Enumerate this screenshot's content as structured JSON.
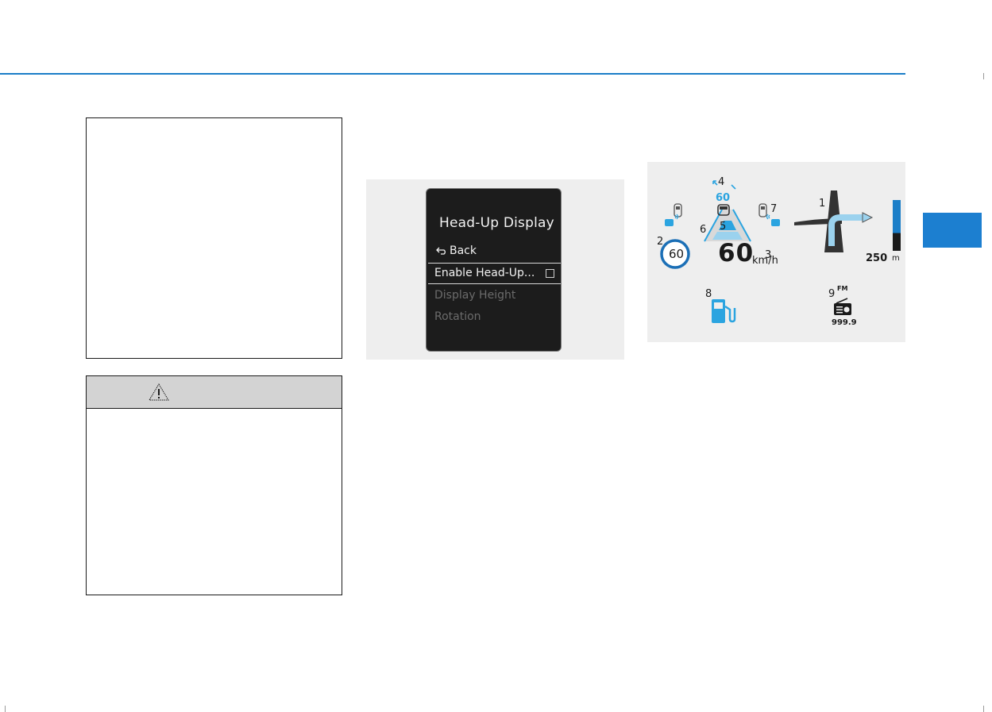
{
  "colors": {
    "accent": "#1b7ec8",
    "tab": "#1c7fd0",
    "hud_blue": "#2ba4e0",
    "lcd_bg": "#1c1c1c",
    "figure_bg": "#eeeeee",
    "warning_header": "#d3d3d3"
  },
  "lcd_menu": {
    "title": "Head-Up Display",
    "back_label": "Back",
    "selected_item": "Enable Head-Up...",
    "selected_checked": false,
    "items": [
      "Display Height",
      "Rotation"
    ]
  },
  "hud": {
    "callouts": [
      "1",
      "2",
      "3",
      "4",
      "5",
      "6",
      "7",
      "8",
      "9"
    ],
    "speed_limit": "60",
    "speed": "60",
    "speed_unit": "km/h",
    "set_speed": "60",
    "distance": "250",
    "distance_unit": "m",
    "radio_band": "FM",
    "radio_freq": "999.9",
    "distance_bar_level": 0.65
  },
  "icons": {
    "warning": "warning-triangle-icon",
    "back": "back-arrow-icon",
    "fuel": "fuel-pump-icon",
    "radio": "radio-icon",
    "car": "car-icon",
    "navigation": "turn-arrow-icon"
  }
}
